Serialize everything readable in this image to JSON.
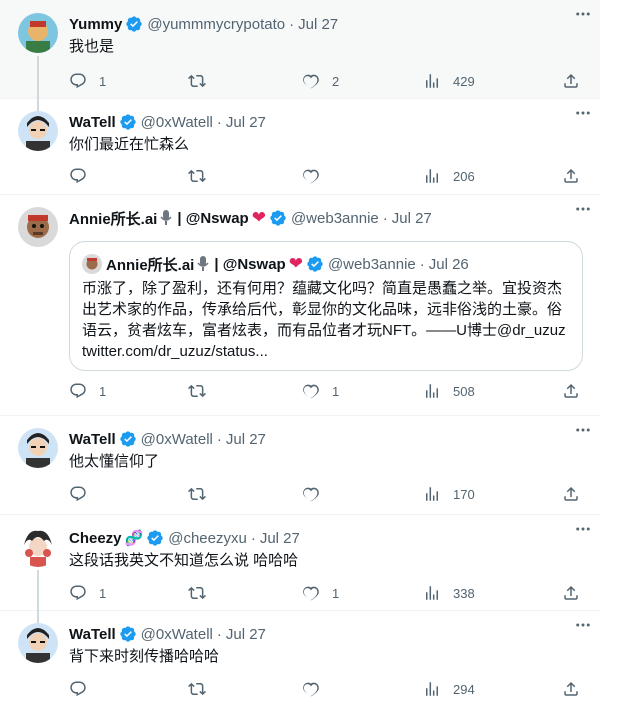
{
  "tweets": [
    {
      "name": "Yummy",
      "handle": "@yummmycrypotato",
      "sep": "·",
      "date": "Jul 27",
      "text": "我也是",
      "counts": {
        "reply": "1",
        "retweet": "",
        "like": "2",
        "views": "429"
      }
    },
    {
      "name": "WaTell",
      "handle": "@0xWatell",
      "sep": "·",
      "date": "Jul 27",
      "text": "你们最近在忙森么",
      "counts": {
        "reply": "",
        "retweet": "",
        "like": "",
        "views": "206"
      }
    },
    {
      "name": "Annie所长.ai",
      "name_suffix": "| @Nswap",
      "handle": "@web3annie",
      "sep": "·",
      "date": "Jul 27",
      "quote": {
        "name": "Annie所长.ai",
        "name_suffix": "| @Nswap",
        "handle": "@web3annie",
        "sep": "·",
        "date": "Jul 26",
        "text": "币涨了，除了盈利，还有何用？蕴藏文化吗？简直是愚蠢之举。宜投资杰出艺术家的作品，传承给后代，彰显你的文化品味，远非俗浅的土豪。俗语云，贫者炫车，富者炫表，而有品位者才玩NFT。——U博士@dr_uzuz twitter.com/dr_uzuz/status..."
      },
      "counts": {
        "reply": "1",
        "retweet": "",
        "like": "1",
        "views": "508"
      }
    },
    {
      "name": "WaTell",
      "handle": "@0xWatell",
      "sep": "·",
      "date": "Jul 27",
      "text": "他太懂信仰了",
      "counts": {
        "reply": "",
        "retweet": "",
        "like": "",
        "views": "170"
      }
    },
    {
      "name": "Cheezy",
      "handle": "@cheezyxu",
      "sep": "·",
      "date": "Jul 27",
      "text": "这段话我英文不知道怎么说 哈哈哈",
      "counts": {
        "reply": "1",
        "retweet": "",
        "like": "1",
        "views": "338"
      }
    },
    {
      "name": "WaTell",
      "handle": "@0xWatell",
      "sep": "·",
      "date": "Jul 27",
      "text": "背下来时刻传播哈哈哈",
      "counts": {
        "reply": "",
        "retweet": "",
        "like": "",
        "views": "294"
      }
    }
  ],
  "icons": {
    "more": "more-icon",
    "reply": "reply-icon",
    "retweet": "retweet-icon",
    "like": "heart-icon",
    "views": "views-icon",
    "share": "share-icon",
    "verified": "verified-badge-icon"
  },
  "colors": {
    "text": "#0f1419",
    "secondary": "#536471",
    "verified": "#1d9bf0",
    "border": "#eff3f4",
    "highlight_bg": "#f7f9f9"
  }
}
